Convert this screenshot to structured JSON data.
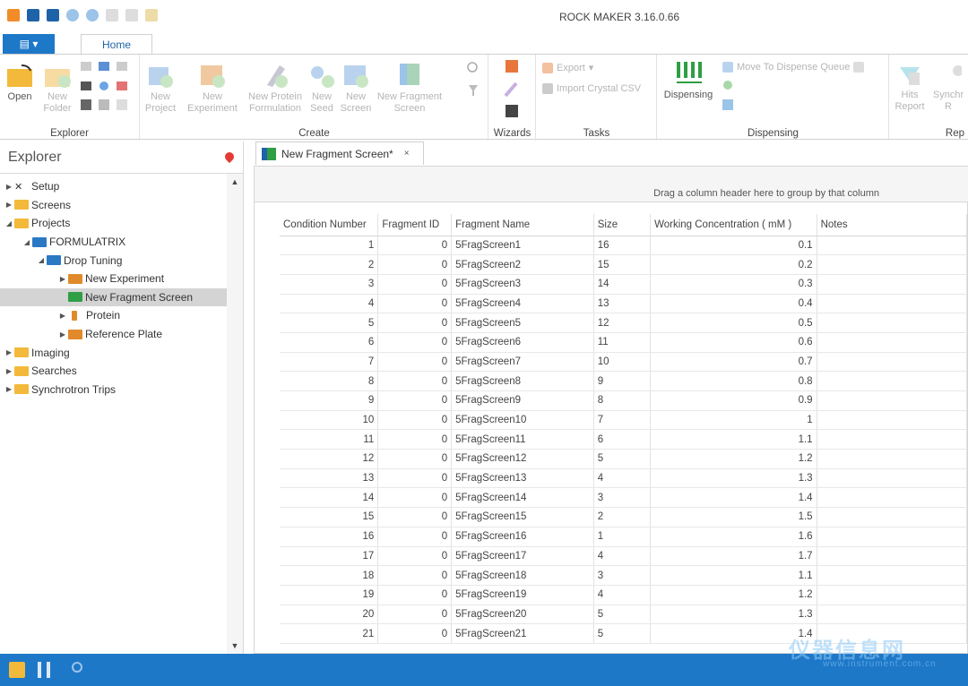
{
  "app_title": "ROCK MAKER 3.16.0.66",
  "ribbon": {
    "file_label": "▤ ▾",
    "tab_home": "Home",
    "groups": {
      "explorer": "Explorer",
      "create": "Create",
      "wizards": "Wizards",
      "tasks": "Tasks",
      "dispensing": "Dispensing",
      "reports": "Rep"
    },
    "buttons": {
      "open": "Open",
      "new_folder_1": "New",
      "new_folder_2": "Folder",
      "new_project_1": "New",
      "new_project_2": "Project",
      "new_experiment_1": "New",
      "new_experiment_2": "Experiment",
      "new_protein_formulation_1": "New Protein",
      "new_protein_formulation_2": "Formulation",
      "new_seed_1": "New",
      "new_seed_2": "Seed",
      "new_screen_1": "New",
      "new_screen_2": "Screen",
      "new_fragment_screen_1": "New Fragment",
      "new_fragment_screen_2": "Screen",
      "export": "Export",
      "import_crystal_csv": "Import Crystal CSV",
      "dispensing": "Dispensing",
      "move_to_dispense_queue": "Move To Dispense Queue",
      "hits_report_1": "Hits",
      "hits_report_2": "Report",
      "synchrotron_1": "Synchr",
      "synchrotron_2": "R"
    }
  },
  "explorer": {
    "title": "Explorer",
    "nodes": [
      {
        "label": "Setup",
        "arrow": "▶",
        "indent": 0
      },
      {
        "label": "Screens",
        "arrow": "▶",
        "indent": 0
      },
      {
        "label": "Projects",
        "arrow": "◢",
        "indent": 0
      },
      {
        "label": "FORMULATRIX",
        "arrow": "◢",
        "indent": 1
      },
      {
        "label": "Drop Tuning",
        "arrow": "◢",
        "indent": 2
      },
      {
        "label": "New Experiment",
        "arrow": "▶",
        "indent": 3
      },
      {
        "label": "New Fragment Screen",
        "arrow": "",
        "indent": 3
      },
      {
        "label": "Protein",
        "arrow": "▶",
        "indent": 3
      },
      {
        "label": "Reference Plate",
        "arrow": "▶",
        "indent": 3
      },
      {
        "label": "Imaging",
        "arrow": "▶",
        "indent": 0
      },
      {
        "label": "Searches",
        "arrow": "▶",
        "indent": 0
      },
      {
        "label": "Synchrotron Trips",
        "arrow": "▶",
        "indent": 0
      }
    ]
  },
  "document": {
    "tab_label": "New Fragment Screen*",
    "close": "×",
    "group_hint": "Drag a column header here to group by that column",
    "columns": [
      "Condition Number",
      "Fragment ID",
      "Fragment Name",
      "Size",
      "Working Concentration ( mM )",
      "Notes"
    ],
    "rows": [
      [
        "1",
        "0",
        "5FragScreen1",
        "16",
        "0.1",
        ""
      ],
      [
        "2",
        "0",
        "5FragScreen2",
        "15",
        "0.2",
        ""
      ],
      [
        "3",
        "0",
        "5FragScreen3",
        "14",
        "0.3",
        ""
      ],
      [
        "4",
        "0",
        "5FragScreen4",
        "13",
        "0.4",
        ""
      ],
      [
        "5",
        "0",
        "5FragScreen5",
        "12",
        "0.5",
        ""
      ],
      [
        "6",
        "0",
        "5FragScreen6",
        "11",
        "0.6",
        ""
      ],
      [
        "7",
        "0",
        "5FragScreen7",
        "10",
        "0.7",
        ""
      ],
      [
        "8",
        "0",
        "5FragScreen8",
        "9",
        "0.8",
        ""
      ],
      [
        "9",
        "0",
        "5FragScreen9",
        "8",
        "0.9",
        ""
      ],
      [
        "10",
        "0",
        "5FragScreen10",
        "7",
        "1",
        ""
      ],
      [
        "11",
        "0",
        "5FragScreen11",
        "6",
        "1.1",
        ""
      ],
      [
        "12",
        "0",
        "5FragScreen12",
        "5",
        "1.2",
        ""
      ],
      [
        "13",
        "0",
        "5FragScreen13",
        "4",
        "1.3",
        ""
      ],
      [
        "14",
        "0",
        "5FragScreen14",
        "3",
        "1.4",
        ""
      ],
      [
        "15",
        "0",
        "5FragScreen15",
        "2",
        "1.5",
        ""
      ],
      [
        "16",
        "0",
        "5FragScreen16",
        "1",
        "1.6",
        ""
      ],
      [
        "17",
        "0",
        "5FragScreen17",
        "4",
        "1.7",
        ""
      ],
      [
        "18",
        "0",
        "5FragScreen18",
        "3",
        "1.1",
        ""
      ],
      [
        "19",
        "0",
        "5FragScreen19",
        "4",
        "1.2",
        ""
      ],
      [
        "20",
        "0",
        "5FragScreen20",
        "5",
        "1.3",
        ""
      ],
      [
        "21",
        "0",
        "5FragScreen21",
        "5",
        "1.4",
        ""
      ]
    ]
  },
  "watermark": {
    "main": "仪器信息网",
    "sub": "www.instrument.com.cn"
  },
  "colors": {
    "accent": "#1e78c8",
    "folder": "#f3b93a",
    "selected_row": "#d4d4d4"
  }
}
